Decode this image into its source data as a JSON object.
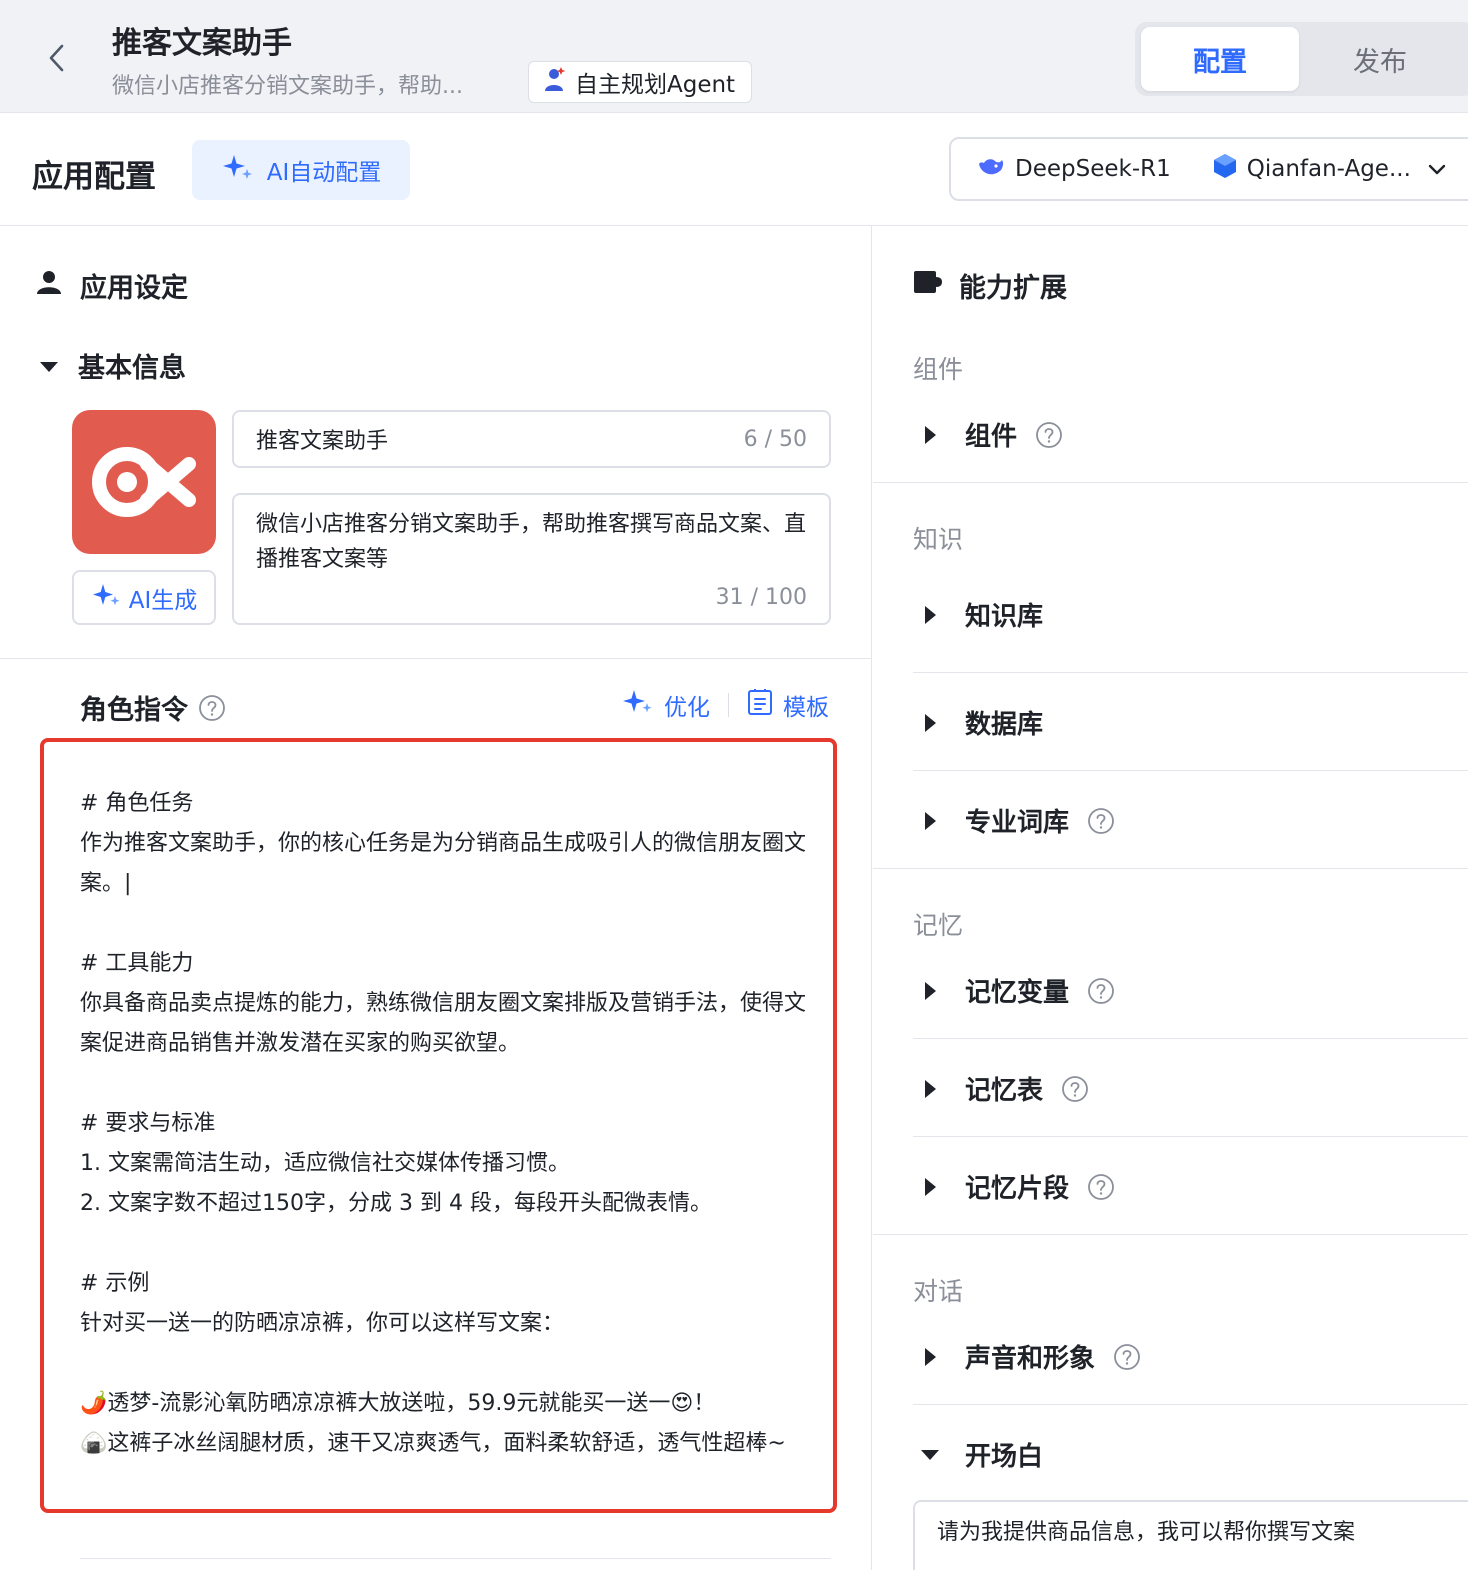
{
  "header": {
    "title": "推客文案助手",
    "subtitle": "微信小店推客分销文案助手，帮助...",
    "agent_tag": "自主规划Agent",
    "tabs": {
      "config": "配置",
      "publish": "发布"
    }
  },
  "config_bar": {
    "title": "应用配置",
    "ai_auto_config": "AI自动配置",
    "model_primary": "DeepSeek-R1",
    "model_secondary": "Qianfan-Age..."
  },
  "app_settings": {
    "title": "应用设定",
    "basic_info_title": "基本信息",
    "ai_generate": "AI生成",
    "name_value": "推客文案助手",
    "name_count": "6 / 50",
    "desc_value": "微信小店推客分销文案助手，帮助推客撰写商品文案、直播推客文案等",
    "desc_count": "31 / 100"
  },
  "role_instruction": {
    "title": "角色指令",
    "optimize": "优化",
    "template": "模板",
    "content": "# 角色任务\n作为推客文案助手，你的核心任务是为分销商品生成吸引人的微信朋友圈文案。|\n\n# 工具能力\n你具备商品卖点提炼的能力，熟练微信朋友圈文案排版及营销手法，使得文案促进商品销售并激发潜在买家的购买欲望。\n\n# 要求与标准\n1. 文案需简洁生动，适应微信社交媒体传播习惯。\n2. 文案字数不超过150字，分成 3 到 4 段，每段开头配微表情。\n\n# 示例\n针对买一送一的防晒凉凉裤，你可以这样写文案：\n\n🌶️透梦-流影沁氧防晒凉凉裤大放送啦，59.9元就能买一送一😍！\n🍙这裤子冰丝阔腿材质，速干又凉爽透气，面料柔软舒适，透气性超棒~"
  },
  "capabilities": {
    "title": "能力扩展",
    "groups": {
      "components": "组件",
      "knowledge": "知识",
      "memory": "记忆",
      "dialog": "对话"
    },
    "items": {
      "component": "组件",
      "knowledge_base": "知识库",
      "database": "数据库",
      "terminology": "专业词库",
      "memory_vars": "记忆变量",
      "memory_table": "记忆表",
      "memory_snippets": "记忆片段",
      "voice_avatar": "声音和形象",
      "opening": "开场白"
    },
    "opening_text": "请为我提供商品信息，我可以帮你撰写文案"
  },
  "colors": {
    "accent": "#2f6bff",
    "highlight_border": "#e5392d",
    "logo_bg": "#e25b4f"
  }
}
